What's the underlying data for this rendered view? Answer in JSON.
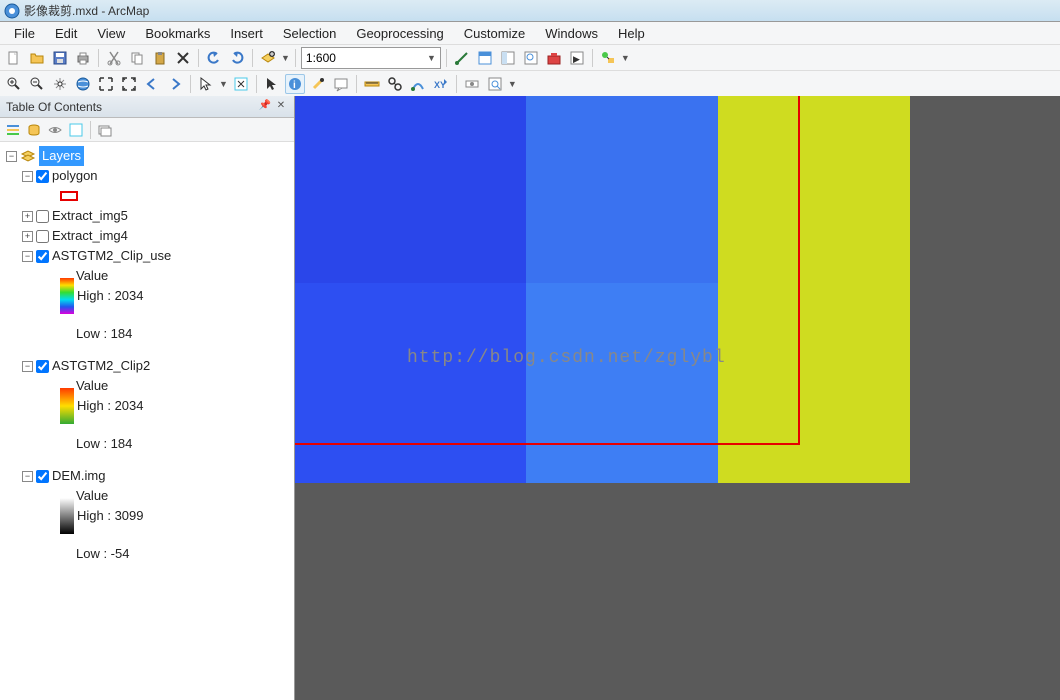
{
  "title": "影像裁剪.mxd - ArcMap",
  "menu": [
    "File",
    "Edit",
    "View",
    "Bookmarks",
    "Insert",
    "Selection",
    "Geoprocessing",
    "Customize",
    "Windows",
    "Help"
  ],
  "scale": "1:600",
  "toc": {
    "title": "Table Of Contents",
    "root": "Layers",
    "layers": {
      "polygon": "polygon",
      "extract5": "Extract_img5",
      "extract4": "Extract_img4",
      "clip_use": "ASTGTM2_Clip_use",
      "clip2": "ASTGTM2_Clip2",
      "dem": "DEM.img"
    },
    "value_label": "Value",
    "clip_use_high": "High : 2034",
    "clip_use_low": "Low : 184",
    "clip2_high": "High : 2034",
    "clip2_low": "Low : 184",
    "dem_high": "High : 3099",
    "dem_low": "Low : -54"
  },
  "watermark": "http://blog.csdn.net/zglybl"
}
